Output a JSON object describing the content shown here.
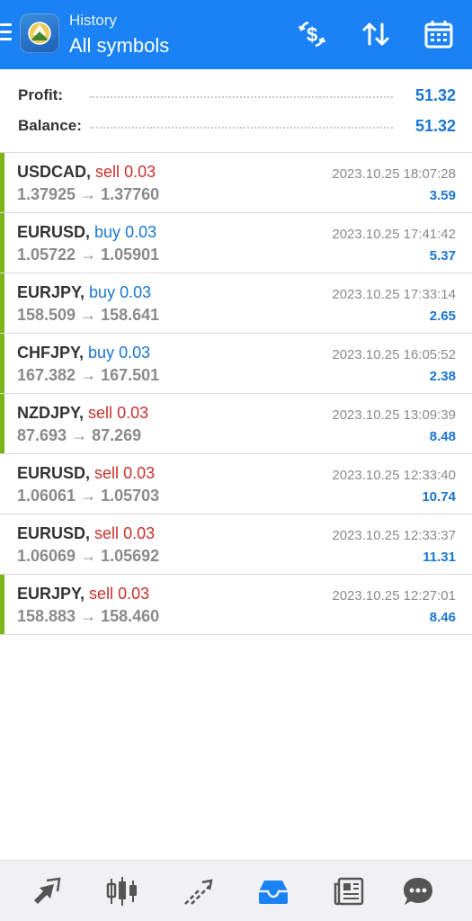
{
  "header": {
    "title_small": "History",
    "title_big": "All symbols",
    "icons": [
      "menu-icon",
      "app-logo",
      "currency-swap-icon",
      "sort-icon",
      "calendar-icon"
    ],
    "color": "#1a82f4"
  },
  "summary": {
    "profit_label": "Profit:",
    "profit_value": "51.32",
    "balance_label": "Balance:",
    "balance_value": "51.32"
  },
  "deals": [
    {
      "symbol": "USDCAD",
      "side": "sell",
      "volume": "0.03",
      "open_price": "1.37925",
      "close_price": "1.37760",
      "time": "2023.10.25 18:07:28",
      "profit": "3.59",
      "highlighted": true
    },
    {
      "symbol": "EURUSD",
      "side": "buy",
      "volume": "0.03",
      "open_price": "1.05722",
      "close_price": "1.05901",
      "time": "2023.10.25 17:41:42",
      "profit": "5.37",
      "highlighted": true
    },
    {
      "symbol": "EURJPY",
      "side": "buy",
      "volume": "0.03",
      "open_price": "158.509",
      "close_price": "158.641",
      "time": "2023.10.25 17:33:14",
      "profit": "2.65",
      "highlighted": true
    },
    {
      "symbol": "CHFJPY",
      "side": "buy",
      "volume": "0.03",
      "open_price": "167.382",
      "close_price": "167.501",
      "time": "2023.10.25 16:05:52",
      "profit": "2.38",
      "highlighted": true
    },
    {
      "symbol": "NZDJPY",
      "side": "sell",
      "volume": "0.03",
      "open_price": "87.693",
      "close_price": "87.269",
      "time": "2023.10.25 13:09:39",
      "profit": "8.48",
      "highlighted": true
    },
    {
      "symbol": "EURUSD",
      "side": "sell",
      "volume": "0.03",
      "open_price": "1.06061",
      "close_price": "1.05703",
      "time": "2023.10.25 12:33:40",
      "profit": "10.74",
      "highlighted": false
    },
    {
      "symbol": "EURUSD",
      "side": "sell",
      "volume": "0.03",
      "open_price": "1.06069",
      "close_price": "1.05692",
      "time": "2023.10.25 12:33:37",
      "profit": "11.31",
      "highlighted": false
    },
    {
      "symbol": "EURJPY",
      "side": "sell",
      "volume": "0.03",
      "open_price": "158.883",
      "close_price": "158.460",
      "time": "2023.10.25 12:27:01",
      "profit": "8.46",
      "highlighted": true
    }
  ],
  "bottom_nav": {
    "items": [
      "quotes-icon",
      "chart-icon",
      "trade-icon",
      "history-icon",
      "news-icon",
      "chat-icon"
    ],
    "active": "history-icon",
    "active_color": "#1a82f4",
    "inactive_color": "#555555"
  },
  "colors": {
    "sell": "#c8302c",
    "buy": "#1a76d2",
    "profit": "#1a76d2",
    "highlight_bar": "#7cb518"
  }
}
